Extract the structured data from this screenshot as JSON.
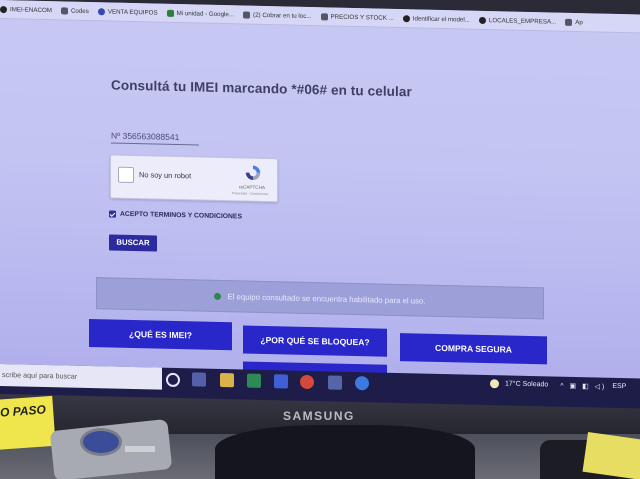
{
  "bookmarks": [
    {
      "label": "IMEI-ENACOM",
      "icon": "home-icon"
    },
    {
      "label": "Codes",
      "icon": "bookmark-icon"
    },
    {
      "label": "VENTA EQUIPOS",
      "icon": "globe-icon"
    },
    {
      "label": "Mi unidad - Google...",
      "icon": "drive-icon"
    },
    {
      "label": "(2) Cobrar en tu loc...",
      "icon": "page-icon"
    },
    {
      "label": "PRECIOS Y STOCK ...",
      "icon": "sheet-icon"
    },
    {
      "label": "Identificar el model...",
      "icon": "apple-icon"
    },
    {
      "label": "LOCALES_EMPRESA...",
      "icon": "globe-icon"
    },
    {
      "label": "Ap",
      "icon": "page-icon"
    }
  ],
  "page": {
    "title": "Consultá tu IMEI marcando *#06# en tu celular",
    "imei_value": "Nº 356563088541",
    "recaptcha": {
      "label": "No soy un robot",
      "brand": "reCAPTCHA",
      "links": "Privacidad - Condiciones"
    },
    "terms_label": "ACEPTO TERMINOS Y CONDICIONES",
    "search_button": "BUSCAR",
    "status_message": "El equipo consultado se encuentra habilitado para el uso.",
    "nav_buttons": {
      "que_es": "¿QUÉ ES IMEI?",
      "por_que": "¿POR QUÉ SE BLOQUEA?",
      "compra": "COMPRA SEGURA"
    }
  },
  "taskbar": {
    "search_placeholder": "scribe aquí para buscar",
    "weather": "17°C  Soleado",
    "language": "ESP",
    "apps": [
      "task-view-icon",
      "file-explorer-icon",
      "excel-icon",
      "app-icon",
      "chrome-icon",
      "calculator-icon",
      "edge-icon"
    ]
  },
  "monitor": {
    "brand": "SAMSUNG"
  },
  "sticker": {
    "text": "O PASO"
  },
  "colors": {
    "screen_bg": "#c3c4f2",
    "button_blue": "#2927c9",
    "title": "#3f3f66",
    "status_ok": "#2a8a4a"
  }
}
